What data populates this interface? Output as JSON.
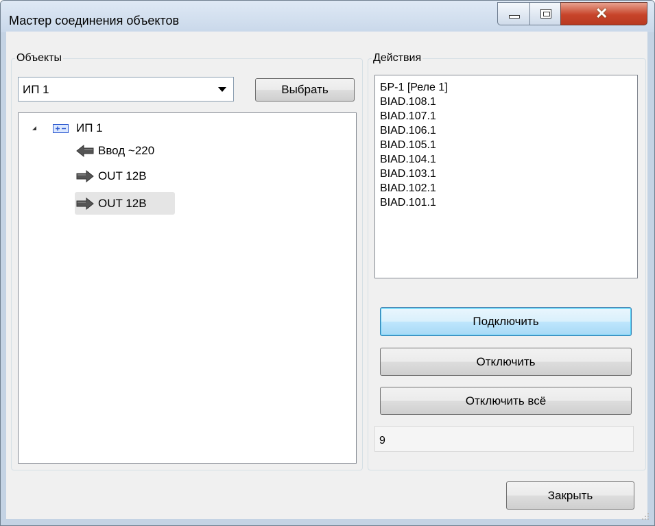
{
  "window": {
    "title": "Мастер соединения объектов",
    "minimize_icon": "minimize-icon",
    "maximize_icon": "maximize-icon",
    "close_icon": "close-icon"
  },
  "objects_panel": {
    "group_label": "Объекты",
    "combo_value": "ИП 1",
    "select_button": "Выбрать",
    "tree": [
      {
        "label": "ИП 1",
        "icon": "device-icon",
        "level": 0,
        "expanded": true
      },
      {
        "label": "Ввод ~220",
        "icon": "arrow-left-icon",
        "level": 1
      },
      {
        "label": "OUT 12B",
        "icon": "arrow-right-icon",
        "level": 1
      },
      {
        "label": "OUT 12B",
        "icon": "arrow-right-icon",
        "level": 1,
        "selected": true
      }
    ]
  },
  "actions_panel": {
    "group_label": "Действия",
    "items": [
      "БР-1 [Реле 1]",
      "BIAD.108.1",
      "BIAD.107.1",
      "BIAD.106.1",
      "BIAD.105.1",
      "BIAD.104.1",
      "BIAD.103.1",
      "BIAD.102.1",
      "BIAD.101.1"
    ],
    "connect_button": "Подключить",
    "disconnect_button": "Отключить",
    "disconnect_all_button": "Отключить всё",
    "count_value": "9"
  },
  "footer": {
    "close_button": "Закрыть"
  }
}
